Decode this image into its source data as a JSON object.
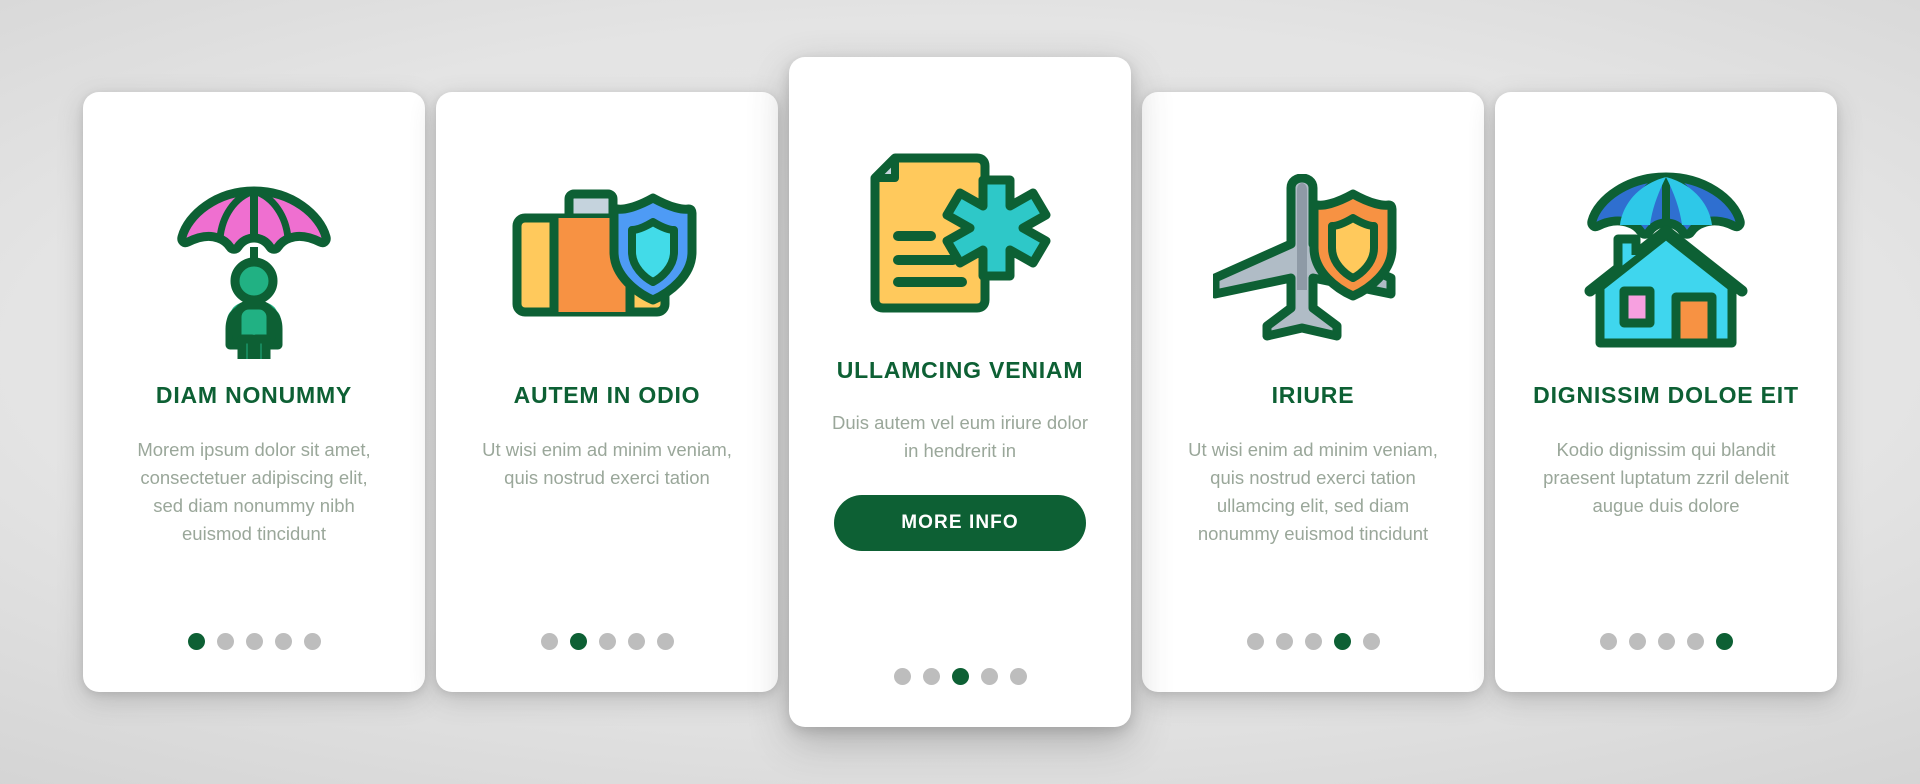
{
  "theme": {
    "brand_green": "#0d6034",
    "muted_text": "#9aa79a",
    "dot_inactive": "#bdbdbd",
    "card_bg": "#ffffff",
    "page_bg": "#d2d2d2"
  },
  "cards": [
    {
      "icon": "person-with-umbrella-icon",
      "title": "DIAM NONUMMY",
      "body": "Morem ipsum dolor sit amet, consectetuer adipiscing elit, sed diam nonummy nibh euismod tincidunt",
      "dots": {
        "count": 5,
        "active_index": 0
      },
      "has_button": false,
      "featured": false
    },
    {
      "icon": "briefcase-shield-icon",
      "title": "AUTEM IN ODIO",
      "body": "Ut wisi enim ad minim veniam, quis nostrud exerci tation",
      "dots": {
        "count": 5,
        "active_index": 1
      },
      "has_button": false,
      "featured": false
    },
    {
      "icon": "medical-document-icon",
      "title": "ULLAMCING VENIAM",
      "body": "Duis autem vel eum iriure dolor in hendrerit in",
      "button_label": "MORE INFO",
      "dots": {
        "count": 5,
        "active_index": 2
      },
      "has_button": true,
      "featured": true
    },
    {
      "icon": "airplane-shield-icon",
      "title": "IRIURE",
      "body": "Ut wisi enim ad minim veniam, quis nostrud exerci tation ullamcing elit, sed diam nonummy euismod tincidunt",
      "dots": {
        "count": 5,
        "active_index": 3
      },
      "has_button": false,
      "featured": false
    },
    {
      "icon": "house-umbrella-icon",
      "title": "DIGNISSIM DOLOE EIT",
      "body": "Kodio dignissim qui blandit praesent luptatum zzril delenit augue duis dolore",
      "dots": {
        "count": 5,
        "active_index": 4
      },
      "has_button": false,
      "featured": false
    }
  ]
}
